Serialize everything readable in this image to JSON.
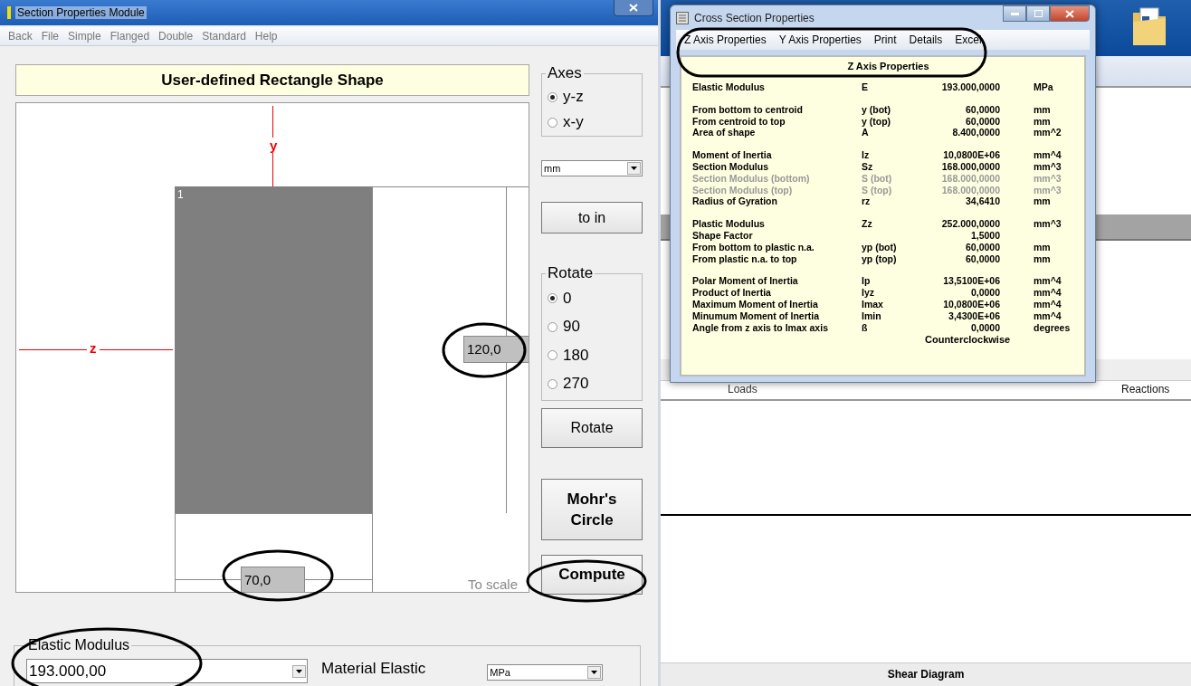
{
  "section_window": {
    "title": "Section Properties Module",
    "menu": [
      "Back",
      "File",
      "Simple",
      "Flanged",
      "Double",
      "Standard",
      "Help"
    ],
    "heading": "User-defined Rectangle Shape",
    "drawing": {
      "y_axis_label": "y",
      "z_axis_label": "z",
      "part_number": "1",
      "height_value": "120,0",
      "width_value": "70,0",
      "scale_note": "To scale"
    },
    "axes": {
      "legend": "Axes",
      "options": [
        {
          "label": "y-z",
          "selected": true
        },
        {
          "label": "x-y",
          "selected": false
        }
      ]
    },
    "unit_select": "mm",
    "convert_button": "to in",
    "rotate": {
      "legend": "Rotate",
      "options": [
        {
          "label": "0",
          "selected": true
        },
        {
          "label": "90",
          "selected": false
        },
        {
          "label": "180",
          "selected": false
        },
        {
          "label": "270",
          "selected": false
        }
      ]
    },
    "rotate_button": "Rotate",
    "mohr_button": "Mohr's Circle",
    "compute_button": "Compute",
    "elastic_modulus": {
      "legend": "Elastic Modulus",
      "value": "193.000,00",
      "label": "Material Elastic",
      "unit": "MPa"
    }
  },
  "background_app": {
    "tabs": [
      "Loads",
      "Reactions"
    ],
    "footer": "Shear Diagram"
  },
  "properties_window": {
    "title": "Cross Section Properties",
    "menu": [
      "Z Axis Properties",
      "Y Axis Properties",
      "Print",
      "Details",
      "Excel"
    ],
    "heading": "Z Axis Properties",
    "groups": [
      {
        "rows": [
          {
            "name": "Elastic Modulus",
            "symbol": "E",
            "value": "193.000,0000",
            "unit": "MPa",
            "disabled": false
          }
        ]
      },
      {
        "rows": [
          {
            "name": "From bottom to centroid",
            "symbol": "y (bot)",
            "value": "60,0000",
            "unit": "mm",
            "disabled": false
          },
          {
            "name": "From centroid to top",
            "symbol": "y (top)",
            "value": "60,0000",
            "unit": "mm",
            "disabled": false
          },
          {
            "name": "Area of shape",
            "symbol": "A",
            "value": "8.400,0000",
            "unit": "mm^2",
            "disabled": false
          }
        ]
      },
      {
        "rows": [
          {
            "name": "Moment of Inertia",
            "symbol": "Iz",
            "value": "10,0800E+06",
            "unit": "mm^4",
            "disabled": false
          },
          {
            "name": "Section Modulus",
            "symbol": "Sz",
            "value": "168.000,0000",
            "unit": "mm^3",
            "disabled": false
          },
          {
            "name": "Section Modulus (bottom)",
            "symbol": "S (bot)",
            "value": "168.000,0000",
            "unit": "mm^3",
            "disabled": true
          },
          {
            "name": "Section Modulus (top)",
            "symbol": "S (top)",
            "value": "168.000,0000",
            "unit": "mm^3",
            "disabled": true
          },
          {
            "name": "Radius of Gyration",
            "symbol": "rz",
            "value": "34,6410",
            "unit": "mm",
            "disabled": false
          }
        ]
      },
      {
        "rows": [
          {
            "name": "Plastic Modulus",
            "symbol": "Zz",
            "value": "252.000,0000",
            "unit": "mm^3",
            "disabled": false
          },
          {
            "name": "Shape Factor",
            "value": "1,5000",
            "disabled": false
          },
          {
            "name": "From bottom to plastic n.a.",
            "symbol": "yp (bot)",
            "value": "60,0000",
            "unit": "mm",
            "disabled": false
          },
          {
            "name": "From plastic n.a. to top",
            "symbol": "yp (top)",
            "value": "60,0000",
            "unit": "mm",
            "disabled": false
          }
        ]
      },
      {
        "rows": [
          {
            "name": "Polar Moment of Inertia",
            "symbol": "Ip",
            "value": "13,5100E+06",
            "unit": "mm^4",
            "disabled": false
          },
          {
            "name": "Product of Inertia",
            "symbol": "Iyz",
            "value": "0,0000",
            "unit": "mm^4",
            "disabled": false
          },
          {
            "name": "Maximum Moment of Inertia",
            "symbol": "Imax",
            "value": "10,0800E+06",
            "unit": "mm^4",
            "disabled": false
          },
          {
            "name": "Minumum Moment of Inertia",
            "symbol": "Imin",
            "value": "3,4300E+06",
            "unit": "mm^4",
            "disabled": false
          },
          {
            "name": "Angle from z axis to Imax axis",
            "symbol": "ß",
            "value": "0,0000",
            "unit": "degrees",
            "disabled": false
          }
        ]
      }
    ],
    "note": "Counterclockwise"
  }
}
